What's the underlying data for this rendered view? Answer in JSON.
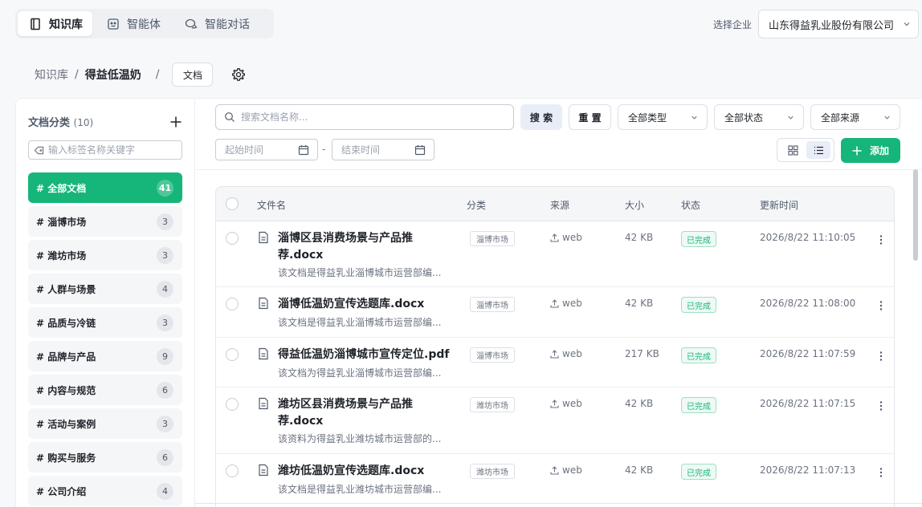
{
  "top_tabs": [
    {
      "label": "知识库",
      "icon": "book-icon",
      "active": true
    },
    {
      "label": "智能体",
      "icon": "agent-icon",
      "active": false
    },
    {
      "label": "智能对话",
      "icon": "chat-icon",
      "active": false
    }
  ],
  "company": {
    "label": "选择企业",
    "value": "山东得益乳业股份有限公司"
  },
  "breadcrumb": {
    "root": "知识库",
    "sep": "/",
    "current": "得益低温奶",
    "chip": "文档"
  },
  "sidebar": {
    "title": "文档分类",
    "count": "(10)",
    "tag_placeholder": "输入标签名称关键字",
    "categories": [
      {
        "label": "# 全部文档",
        "count": "41",
        "active": true
      },
      {
        "label": "# 淄博市场",
        "count": "3"
      },
      {
        "label": "# 潍坊市场",
        "count": "3"
      },
      {
        "label": "# 人群与场景",
        "count": "4"
      },
      {
        "label": "# 品质与冷链",
        "count": "3"
      },
      {
        "label": "# 品牌与产品",
        "count": "9"
      },
      {
        "label": "# 内容与规范",
        "count": "6"
      },
      {
        "label": "# 活动与案例",
        "count": "3"
      },
      {
        "label": "# 购买与服务",
        "count": "6"
      },
      {
        "label": "# 公司介绍",
        "count": "4"
      }
    ]
  },
  "filters": {
    "search_placeholder": "搜索文档名称...",
    "search_btn": "搜 索",
    "reset_btn": "重 置",
    "type": "全部类型",
    "status": "全部状态",
    "source": "全部来源",
    "start_placeholder": "起始时间",
    "end_placeholder": "结束时间",
    "date_sep": "-",
    "add_btn": "添加"
  },
  "table": {
    "headers": {
      "name": "文件名",
      "category": "分类",
      "source": "来源",
      "size": "大小",
      "status": "状态",
      "updated": "更新时间"
    },
    "rows": [
      {
        "name": "淄博区县消费场景与产品推荐.docx",
        "desc": "该文档是得益乳业淄博城市运营部编...",
        "category": "淄博市场",
        "source": "web",
        "size": "42 KB",
        "status": "已完成",
        "updated": "2026/8/22 11:10:05"
      },
      {
        "name": "淄博低温奶宣传选题库.docx",
        "desc": "该文档是得益乳业淄博城市运营部编...",
        "category": "淄博市场",
        "source": "web",
        "size": "42 KB",
        "status": "已完成",
        "updated": "2026/8/22 11:08:00"
      },
      {
        "name": "得益低温奶淄博城市宣传定位.pdf",
        "desc": "该文档为得益乳业淄博城市运营部编...",
        "category": "淄博市场",
        "source": "web",
        "size": "217 KB",
        "status": "已完成",
        "updated": "2026/8/22 11:07:59"
      },
      {
        "name": "潍坊区县消费场景与产品推荐.docx",
        "desc": "该资料为得益乳业潍坊城市运营部的...",
        "category": "潍坊市场",
        "source": "web",
        "size": "42 KB",
        "status": "已完成",
        "updated": "2026/8/22 11:07:15"
      },
      {
        "name": "潍坊低温奶宣传选题库.docx",
        "desc": "该文档是得益乳业潍坊城市运营部编...",
        "category": "潍坊市场",
        "source": "web",
        "size": "42 KB",
        "status": "已完成",
        "updated": "2026/8/22 11:07:13"
      }
    ]
  },
  "colors": {
    "accent": "#16b57a",
    "status_text": "#16b57a"
  }
}
